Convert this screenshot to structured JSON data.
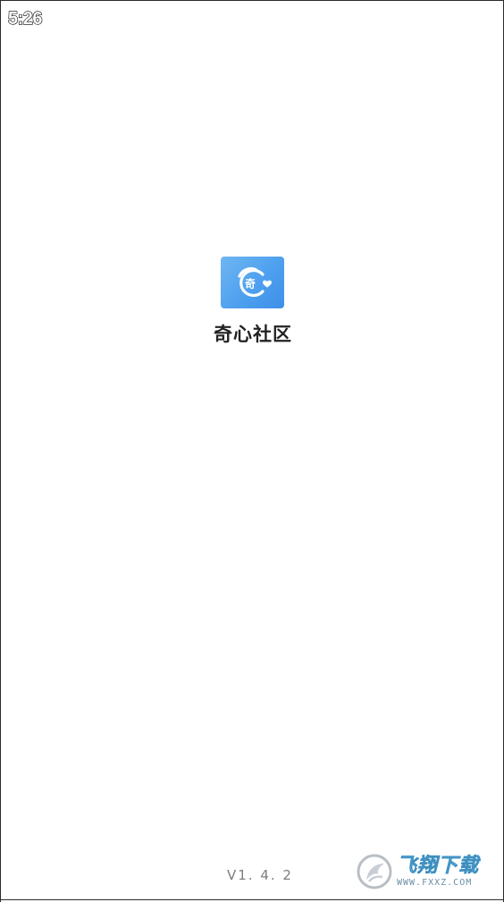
{
  "status_bar": {
    "time": "5:26"
  },
  "splash": {
    "app_icon": {
      "icon": "app-logo-icon",
      "glyph": "奇",
      "accent_color": "#4ea0ef"
    },
    "app_name": "奇心社区",
    "version": "V1. 4. 2"
  },
  "watermark": {
    "icon": "watermark-logo-icon",
    "text_cn": "飞翔下载",
    "text_en": "WWW.FXXZ.COM"
  }
}
